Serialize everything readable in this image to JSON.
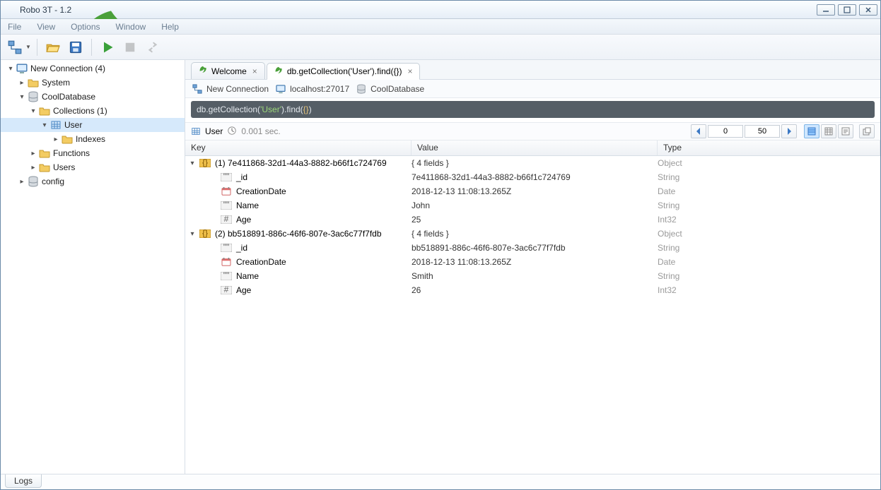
{
  "window": {
    "title": "Robo 3T - 1.2"
  },
  "menu": {
    "file": "File",
    "view": "View",
    "options": "Options",
    "window": "Window",
    "help": "Help"
  },
  "tree": {
    "connection": "New Connection (4)",
    "system": "System",
    "db": "CoolDatabase",
    "collections": "Collections (1)",
    "user": "User",
    "indexes": "Indexes",
    "functions": "Functions",
    "users": "Users",
    "config": "config"
  },
  "tabs": {
    "welcome": "Welcome",
    "query": "db.getCollection('User').find({})"
  },
  "breadcrumb": {
    "conn": "New Connection",
    "host": "localhost:27017",
    "db": "CoolDatabase"
  },
  "query": {
    "prefix": "db.getCollection(",
    "arg": "'User'",
    "mid": ").find(",
    "arg2": "{}",
    "suffix": ")"
  },
  "resbar": {
    "collection": "User",
    "time": "0.001 sec.",
    "skip": "0",
    "limit": "50"
  },
  "grid": {
    "headers": {
      "key": "Key",
      "value": "Value",
      "type": "Type"
    },
    "rows": [
      {
        "depth": 0,
        "open": true,
        "iconType": "obj",
        "key": "(1) 7e411868-32d1-44a3-8882-b66f1c724769",
        "value": "{ 4 fields }",
        "type": "Object"
      },
      {
        "depth": 1,
        "iconType": "str",
        "key": "_id",
        "value": "7e411868-32d1-44a3-8882-b66f1c724769",
        "type": "String"
      },
      {
        "depth": 1,
        "iconType": "date",
        "key": "CreationDate",
        "value": "2018-12-13 11:08:13.265Z",
        "type": "Date"
      },
      {
        "depth": 1,
        "iconType": "str",
        "key": "Name",
        "value": "John",
        "type": "String"
      },
      {
        "depth": 1,
        "iconType": "int",
        "key": "Age",
        "value": "25",
        "type": "Int32"
      },
      {
        "depth": 0,
        "open": true,
        "iconType": "obj",
        "key": "(2) bb518891-886c-46f6-807e-3ac6c77f7fdb",
        "value": "{ 4 fields }",
        "type": "Object"
      },
      {
        "depth": 1,
        "iconType": "str",
        "key": "_id",
        "value": "bb518891-886c-46f6-807e-3ac6c77f7fdb",
        "type": "String"
      },
      {
        "depth": 1,
        "iconType": "date",
        "key": "CreationDate",
        "value": "2018-12-13 11:08:13.265Z",
        "type": "Date"
      },
      {
        "depth": 1,
        "iconType": "str",
        "key": "Name",
        "value": "Smith",
        "type": "String"
      },
      {
        "depth": 1,
        "iconType": "int",
        "key": "Age",
        "value": "26",
        "type": "Int32"
      }
    ]
  },
  "bottom": {
    "logs": "Logs"
  }
}
